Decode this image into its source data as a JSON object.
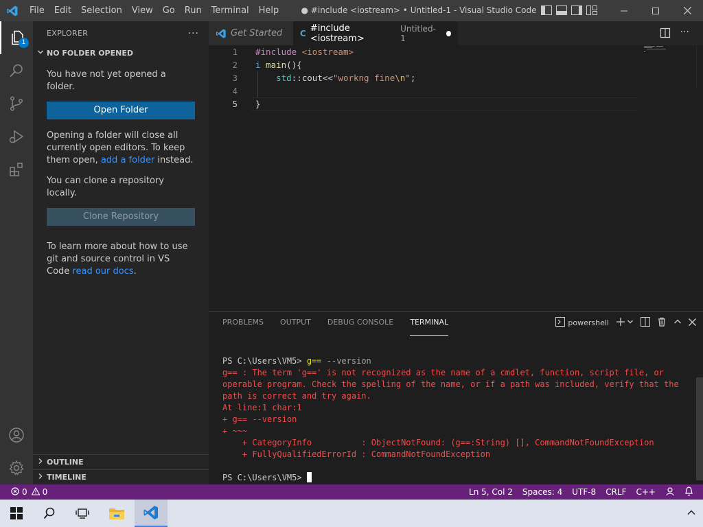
{
  "titlebar": {
    "menus": [
      "File",
      "Edit",
      "Selection",
      "View",
      "Go",
      "Run",
      "Terminal",
      "Help"
    ],
    "window_title": "● #include <iostream> • Untitled-1 - Visual Studio Code"
  },
  "activity": {
    "explorer_badge": "1",
    "icons": [
      "files-icon",
      "search-icon",
      "source-control-icon",
      "run-debug-icon",
      "extensions-icon",
      "account-icon",
      "settings-gear-icon"
    ]
  },
  "sidebar": {
    "title": "EXPLORER",
    "more": "···",
    "section_title": "NO FOLDER OPENED",
    "not_opened": "You have not yet opened a folder.",
    "open_folder_button": "Open Folder",
    "close_info_before": "Opening a folder will close all currently open editors. To keep them open, ",
    "close_info_link": "add a folder",
    "close_info_after": " instead.",
    "clone_info": "You can clone a repository locally.",
    "clone_button": "Clone Repository",
    "docs_before": "To learn more about how to use git and source control in VS Code ",
    "docs_link": "read our docs",
    "docs_after": ".",
    "outline": "OUTLINE",
    "timeline": "TIMELINE"
  },
  "tabs": {
    "get_started": "Get Started",
    "untitled_label": "#include <iostream>",
    "untitled_desc": "Untitled-1"
  },
  "editor": {
    "line_numbers": [
      "1",
      "2",
      "3",
      "4",
      "5"
    ],
    "l1_pre": "#include",
    "l1_inc": " <iostream>",
    "l2_kw": "i",
    "l2_fn": " main",
    "l2_rest": "(){",
    "l3_indent": "    ",
    "l3_ns": "std",
    "l3_op": "::cout<<",
    "l3_str": "\"workng fine",
    "l3_esc": "\\n",
    "l3_end": "\"",
    "l3_semi": ";",
    "l5_code": "}"
  },
  "panel": {
    "tabs": [
      "PROBLEMS",
      "OUTPUT",
      "DEBUG CONSOLE",
      "TERMINAL"
    ],
    "active_tab": "TERMINAL",
    "shell": "powershell",
    "terminal": {
      "prompt": "PS C:\\Users\\VM5> ",
      "cmd": "g==",
      "arg": " --version",
      "errors": [
        "g== : The term 'g==' is not recognized as the name of a cmdlet, function, script file, or",
        "operable program. Check the spelling of the name, or if a path was included, verify that the",
        "path is correct and try again.",
        "At line:1 char:1",
        "+ g== --version",
        "+ ~~~",
        "    + CategoryInfo          : ObjectNotFound: (g==:String) [], CommandNotFoundException",
        "    + FullyQualifiedErrorId : CommandNotFoundException"
      ],
      "final_prompt": "PS C:\\Users\\VM5> "
    }
  },
  "statusbar": {
    "errors": "0",
    "warnings": "0",
    "position": "Ln 5, Col 2",
    "spaces": "Spaces: 4",
    "encoding": "UTF-8",
    "eol": "CRLF",
    "language": "C++"
  },
  "colors": {
    "statusbar_bg": "#68217a",
    "accent_button": "#0e639c",
    "terminal_error": "#f14c4c"
  }
}
